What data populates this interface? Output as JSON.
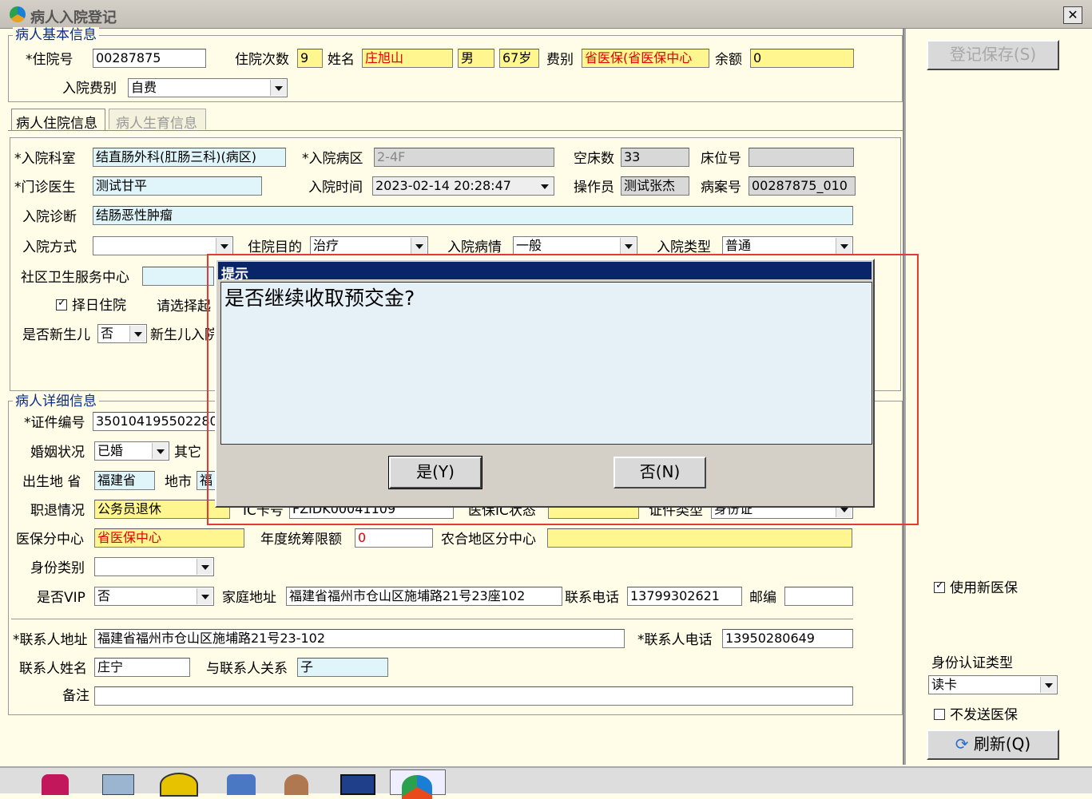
{
  "window": {
    "title": "病人入院登记",
    "close": "✕"
  },
  "basic": {
    "group_title": "病人基本信息",
    "inpatient_no_label": "*住院号",
    "inpatient_no": "00287875",
    "times_label": "住院次数",
    "times": "9",
    "name_label": "姓名",
    "name": "庄旭山",
    "sex": "男",
    "age": "67岁",
    "fee_type_label": "费别",
    "fee_type": "省医保(省医保中心",
    "balance_label": "余额",
    "balance": "0",
    "admit_fee_label": "入院费别",
    "admit_fee": "自费"
  },
  "tabs": [
    {
      "label": "病人住院信息"
    },
    {
      "label": "病人生育信息"
    }
  ],
  "admission": {
    "dept_label": "*入院科室",
    "dept": "结直肠外科(肛肠三科)(病区)",
    "ward_label": "*入院病区",
    "ward": "2-4F",
    "empty_beds_label": "空床数",
    "empty_beds": "33",
    "bed_no_label": "床位号",
    "bed_no": "",
    "doctor_label": "*门诊医生",
    "doctor": "测试甘平",
    "time_label": "入院时间",
    "time": "2023-02-14 20:28:47",
    "operator_label": "操作员",
    "operator": "测试张杰",
    "record_no_label": "病案号",
    "record_no": "00287875_010",
    "diagnosis_label": "入院诊断",
    "diagnosis": "结肠恶性肿瘤",
    "mode_label": "入院方式",
    "mode": "",
    "purpose_label": "住院目的",
    "purpose": "治疗",
    "condition_label": "入院病情",
    "condition": "一般",
    "type_label": "入院类型",
    "type": "普通",
    "community_label": "社区卫生服务中心",
    "select_day_label": "择日住院",
    "select_hint": "请选择起",
    "newborn_label": "是否新生儿",
    "newborn": "否",
    "newborn_admit_label": "新生儿入院"
  },
  "detail": {
    "group_title": "病人详细信息",
    "id_no_label": "*证件编号",
    "id_no": "3501041955022800",
    "marital_label": "婚姻状况",
    "marital": "已婚",
    "other_label": "其它",
    "birth_label": "出生地 省",
    "birth_province": "福建省",
    "city_label": "地市",
    "city": "福",
    "job_label": "职退情况",
    "job": "公务员退休",
    "card_label": "IC卡号",
    "card": "FZIDK00041109",
    "insurance_status_label": "医保IC状态",
    "id_type_label": "证件类型",
    "id_type": "身份证",
    "center_label": "医保分中心",
    "center": "省医保中心",
    "annual_label": "年度统筹限额",
    "annual": "0",
    "rural_label": "农合地区分中心",
    "rural": "",
    "identity_label": "身份类别",
    "identity": "",
    "vip_label": "是否VIP",
    "vip": "否",
    "address_label": "家庭地址",
    "address": "福建省福州市仓山区施埔路21号23座102",
    "phone_label": "联系电话",
    "phone": "13799302621",
    "zip_label": "邮编",
    "zip": "",
    "contact_addr_label": "*联系人地址",
    "contact_addr": "福建省福州市仓山区施埔路21号23-102",
    "contact_phone_label": "*联系人电话",
    "contact_phone": "13950280649",
    "contact_name_label": "联系人姓名",
    "contact_name": "庄宁",
    "relation_label": "与联系人关系",
    "relation": "子",
    "remark_label": "备注",
    "remark": ""
  },
  "right_panel": {
    "save_button": "登记保存(S)",
    "new_insurance_label": "使用新医保",
    "auth_type_label": "身份认证类型",
    "auth_type": "读卡",
    "no_send_label": "不发送医保",
    "refresh_button": "刷新(Q)"
  },
  "dialog": {
    "title": "提示",
    "message": "是否继续收取预交金?",
    "yes": "是(Y)",
    "no": "否(N)"
  },
  "colors": {
    "title_blue": "#0a246a",
    "highlight_red": "#e53935"
  }
}
